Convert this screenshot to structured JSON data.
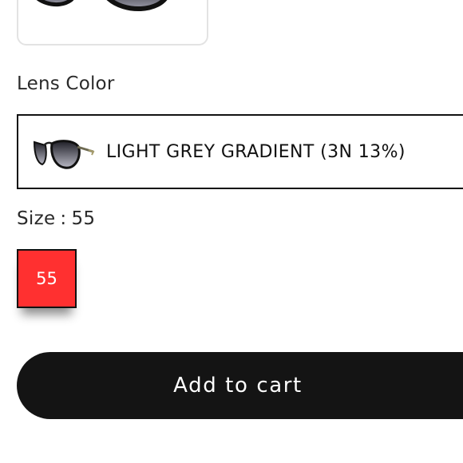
{
  "product_thumbnail": {
    "icon": "sunglasses-icon"
  },
  "lens_color": {
    "label": "Lens Color",
    "selected_value": "LIGHT GREY GRADIENT (3N 13%)",
    "swatch_icon": "sunglasses-icon"
  },
  "size": {
    "label": "Size",
    "separator": ":",
    "selected_value": "55",
    "options": [
      "55"
    ],
    "selected_color": "#ff3030"
  },
  "cart": {
    "button_label": "Add to cart",
    "button_color": "#141414"
  }
}
